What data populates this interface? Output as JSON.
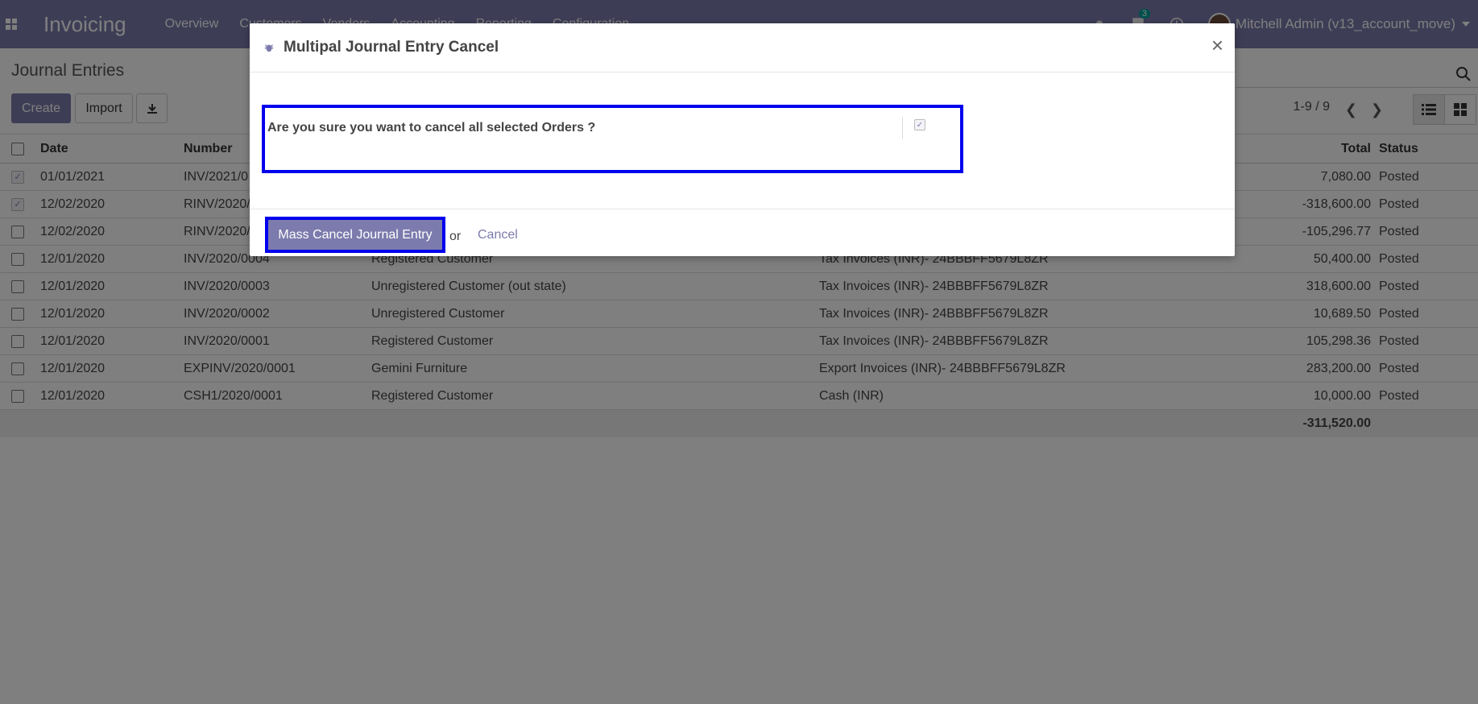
{
  "navbar": {
    "app_title": "Invoicing",
    "menu": [
      "Overview",
      "Customers",
      "Vendors",
      "Accounting",
      "Reporting",
      "Configuration"
    ],
    "chat_count": "3",
    "user": "Mitchell Admin (v13_account_move)"
  },
  "control": {
    "breadcrumb": "Journal Entries",
    "create_label": "Create",
    "import_label": "Import",
    "pager": "1-9 / 9"
  },
  "table": {
    "headers": {
      "date": "Date",
      "number": "Number",
      "total": "Total",
      "status": "Status"
    },
    "rows": [
      {
        "checked": true,
        "date": "01/01/2021",
        "number": "INV/2021/0",
        "partner": "",
        "journal": "",
        "total": "7,080.00",
        "status": "Posted"
      },
      {
        "checked": true,
        "date": "12/02/2020",
        "number": "RINV/2020/",
        "partner": "",
        "journal": "",
        "total": "-318,600.00",
        "status": "Posted"
      },
      {
        "checked": false,
        "date": "12/02/2020",
        "number": "RINV/2020/",
        "partner": "",
        "journal": "",
        "total": "-105,296.77",
        "status": "Posted"
      },
      {
        "checked": false,
        "date": "12/01/2020",
        "number": "INV/2020/0004",
        "partner": "Registered Customer",
        "journal": "Tax Invoices (INR)- 24BBBFF5679L8ZR",
        "total": "50,400.00",
        "status": "Posted"
      },
      {
        "checked": false,
        "date": "12/01/2020",
        "number": "INV/2020/0003",
        "partner": "Unregistered Customer (out state)",
        "journal": "Tax Invoices (INR)- 24BBBFF5679L8ZR",
        "total": "318,600.00",
        "status": "Posted"
      },
      {
        "checked": false,
        "date": "12/01/2020",
        "number": "INV/2020/0002",
        "partner": "Unregistered Customer",
        "journal": "Tax Invoices (INR)- 24BBBFF5679L8ZR",
        "total": "10,689.50",
        "status": "Posted"
      },
      {
        "checked": false,
        "date": "12/01/2020",
        "number": "INV/2020/0001",
        "partner": "Registered Customer",
        "journal": "Tax Invoices (INR)- 24BBBFF5679L8ZR",
        "total": "105,298.36",
        "status": "Posted"
      },
      {
        "checked": false,
        "date": "12/01/2020",
        "number": "EXPINV/2020/0001",
        "partner": "Gemini Furniture",
        "journal": "Export Invoices (INR)- 24BBBFF5679L8ZR",
        "total": "283,200.00",
        "status": "Posted"
      },
      {
        "checked": false,
        "date": "12/01/2020",
        "number": "CSH1/2020/0001",
        "partner": "Registered Customer",
        "journal": "Cash (INR)",
        "total": "10,000.00",
        "status": "Posted"
      }
    ],
    "footer_total": "-311,520.00"
  },
  "modal": {
    "title": "Multipal Journal Entry Cancel",
    "close": "×",
    "confirm_label": "Are you sure you want to cancel all selected Orders ?",
    "confirm_checked": true,
    "mass_cancel_label": "Mass Cancel Journal Entry",
    "or_text": "or",
    "cancel_label": "Cancel"
  }
}
